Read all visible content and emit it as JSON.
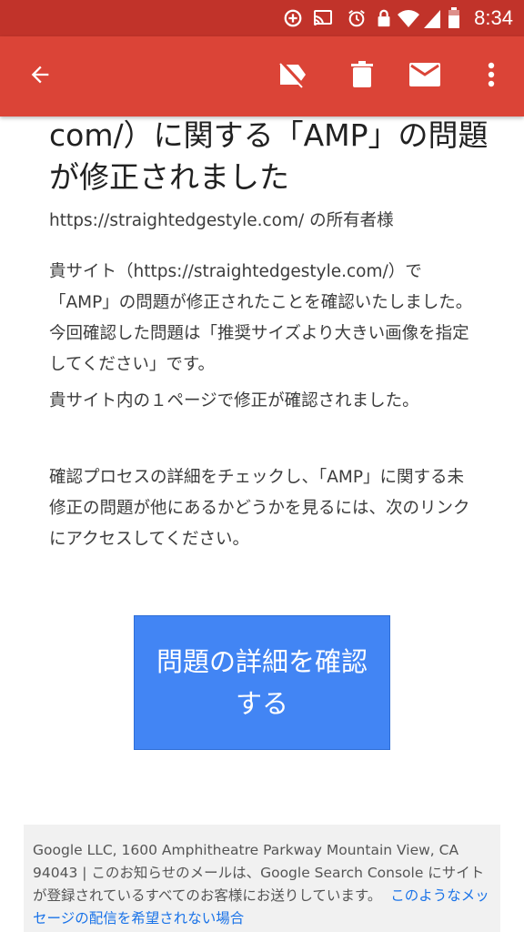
{
  "status_bar": {
    "time": "8:34",
    "icons": [
      "add-circle-icon",
      "cast-icon",
      "alarm-icon",
      "lock-icon",
      "wifi-icon",
      "signal-icon",
      "battery-icon"
    ]
  },
  "app_bar": {
    "icons": [
      "back-arrow-icon",
      "label-off-icon",
      "trash-icon",
      "mail-icon",
      "more-vert-icon"
    ],
    "color": "#db4437"
  },
  "email": {
    "title": "com/）に関する「AMP」の問題が修正されました",
    "greeting": "https://straightedgestyle.com/ の所有者様",
    "paragraph1": "貴サイト（https://straightedgestyle.com/）で「AMP」の問題が修正されたことを確認いたしました。今回確認した問題は「推奨サイズより大きい画像を指定してください」です。",
    "paragraph2": "貴サイト内の１ページで修正が確認されました。",
    "paragraph3": "確認プロセスの詳細をチェックし、「AMP」に関する未修正の問題が他にあるかどうかを見るには、次のリンクにアクセスしてください。",
    "cta_label": "問題の詳細を確認する",
    "cta_color": "#4285f4",
    "footer_text": "Google LLC, 1600 Amphitheatre Parkway Mountain View, CA 94043 | このお知らせのメールは、Google Search Console にサイトが登録されているすべてのお客様にお送りしています。",
    "footer_link": "このようなメッセージの配信を希望されない場合"
  }
}
